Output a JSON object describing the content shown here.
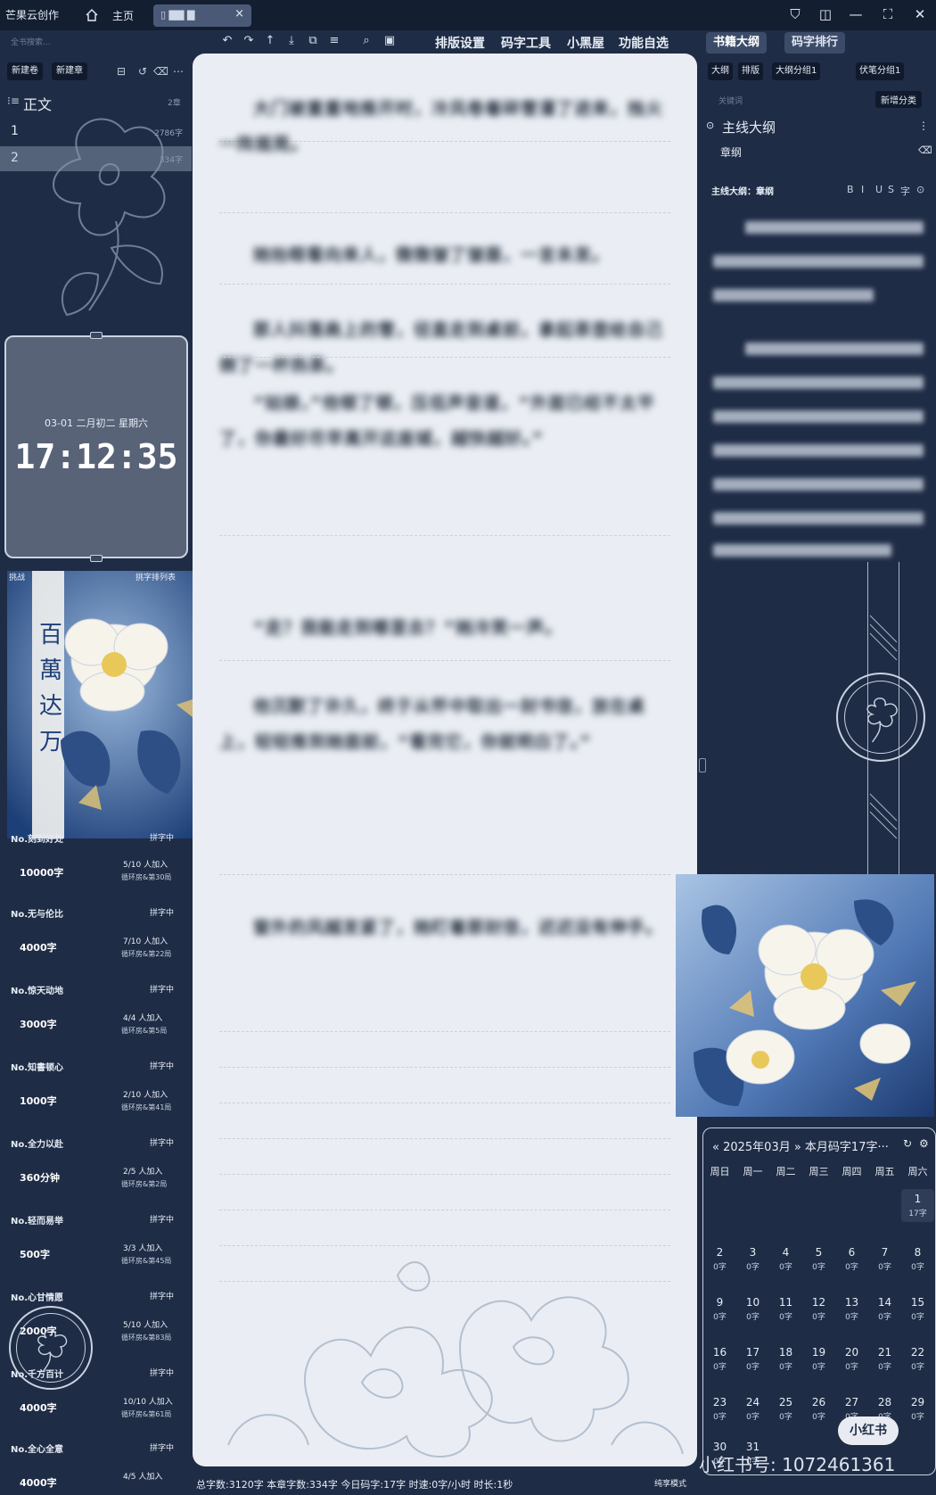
{
  "titlebar": {
    "app_name": "芒果云创作",
    "home_tab": "主页",
    "doc_tab_close": "×"
  },
  "left": {
    "search_placeholder": "全书搜索...",
    "new_volume": "新建卷",
    "new_chapter": "新建章",
    "section_label": "正文",
    "section_count": "2章",
    "chapters": [
      {
        "num": "1",
        "words": "2786字"
      },
      {
        "num": "2",
        "words": "334字"
      }
    ],
    "clock": {
      "date": "03-01  二月初二  星期六",
      "time": "17:12:35"
    },
    "challenge_header_left": "挑战",
    "challenge_header_right": "挑字排列表",
    "challenges": [
      {
        "title": "No.无与伦比",
        "status": "拼字中",
        "target": "4000字",
        "progress": "7/10 人加入",
        "rank": "循环房&第22局"
      },
      {
        "title": "No.惊天动地",
        "status": "拼字中",
        "target": "3000字",
        "progress": "4/4 人加入",
        "rank": "循环房&第5局"
      },
      {
        "title": "No.知書顿心",
        "status": "拼字中",
        "target": "1000字",
        "progress": "2/10 人加入",
        "rank": "循环房&第41局"
      },
      {
        "title": "No.全力以赴",
        "status": "拼字中",
        "target": "360分钟",
        "progress": "2/5 人加入",
        "rank": "循环房&第2局"
      },
      {
        "title": "No.轻而易举",
        "status": "拼字中",
        "target": "500字",
        "progress": "3/3 人加入",
        "rank": "循环房&第45局"
      },
      {
        "title": "No.心甘情愿",
        "status": "拼字中",
        "target": "2000字",
        "progress": "5/10 人加入",
        "rank": "循环房&第83局"
      },
      {
        "title": "No.千方百计",
        "status": "拼字中",
        "target": "4000字",
        "progress": "10/10 人加入",
        "rank": "循环房&第61局"
      },
      {
        "title": "No.全心全意",
        "status": "拼字中",
        "target": "4000字",
        "progress": "4/5 人加入",
        "rank": ""
      }
    ],
    "pre_items": [
      {
        "title": "No.刻到好处",
        "status": "拼字中",
        "target": "10000字",
        "progress": "5/10 人加入",
        "rank": "循环房&第30局"
      },
      {
        "title": "",
        "status": "",
        "target": "500字",
        "progress": "10/10 人加入",
        "rank": ""
      }
    ]
  },
  "toolbar": {
    "menu": [
      "排版设置",
      "码字工具",
      "小黑屋",
      "功能自选"
    ],
    "icons": [
      "undo-icon",
      "redo-icon",
      "arrow-up-icon",
      "arrow-down-icon",
      "copy-icon",
      "format-icon",
      "search-icon",
      "save-icon"
    ]
  },
  "editor": {
    "paragraphs": [
      "大门被重重地推开时，冷风卷着碎雪灌了进来，烛火一阵摇晃。",
      "她抬眼看向来人，微微皱了皱眉，一言未发。",
      "那人抖落肩上的雪，径直走到桌前，拿起茶壶给自己倒了一杯热茶。",
      "“姑娘，”他顿了顿，压低声音道，“外面已经不太平了，你最好尽早离开这座城，越快越好。”",
      "“走？我能走到哪里去？”她冷笑一声。",
      "他沉默了许久，终于从怀中取出一封书信，放在桌上，轻轻推到她面前，“看完它，你就明白了。”",
      "窗外的风越发紧了，她盯着那封信，迟迟没有伸手。"
    ]
  },
  "status_bar": {
    "text": "总字数:3120字  本章字数:334字  今日码字:17字  时速:0字/小时  时长:1秒",
    "mode": "纯享模式"
  },
  "right": {
    "tab_outline": "书籍大纲",
    "tab_rank": "码字排行",
    "subtabs": [
      "大纲",
      "排版",
      "大纲分组1",
      "伏笔分组1"
    ],
    "keyword_placeholder": "关键词",
    "new_category": "新增分类",
    "main_outline": "主线大纲",
    "chapter_outline": "章纲",
    "breadcrumb": "主线大纲：章纲",
    "format_buttons": [
      "B",
      "I",
      "U",
      "S",
      "字",
      "⊙"
    ],
    "outline_lines": 10
  },
  "calendar": {
    "month_label": "« 2025年03月 » 本月码字17字···",
    "weekdays": [
      "周日",
      "周一",
      "周二",
      "周三",
      "周四",
      "周五",
      "周六"
    ],
    "days": [
      {
        "d": "1",
        "w": "17字"
      },
      {
        "d": "2",
        "w": "0字"
      },
      {
        "d": "3",
        "w": "0字"
      },
      {
        "d": "4",
        "w": "0字"
      },
      {
        "d": "5",
        "w": "0字"
      },
      {
        "d": "6",
        "w": "0字"
      },
      {
        "d": "7",
        "w": "0字"
      },
      {
        "d": "8",
        "w": "0字"
      },
      {
        "d": "9",
        "w": "0字"
      },
      {
        "d": "10",
        "w": "0字"
      },
      {
        "d": "11",
        "w": "0字"
      },
      {
        "d": "12",
        "w": "0字"
      },
      {
        "d": "13",
        "w": "0字"
      },
      {
        "d": "14",
        "w": "0字"
      },
      {
        "d": "15",
        "w": "0字"
      },
      {
        "d": "16",
        "w": "0字"
      },
      {
        "d": "17",
        "w": "0字"
      },
      {
        "d": "18",
        "w": "0字"
      },
      {
        "d": "19",
        "w": "0字"
      },
      {
        "d": "20",
        "w": "0字"
      },
      {
        "d": "21",
        "w": "0字"
      },
      {
        "d": "22",
        "w": "0字"
      },
      {
        "d": "23",
        "w": "0字"
      },
      {
        "d": "24",
        "w": "0字"
      },
      {
        "d": "25",
        "w": "0字"
      },
      {
        "d": "26",
        "w": "0字"
      },
      {
        "d": "27",
        "w": "0字"
      },
      {
        "d": "28",
        "w": "0字"
      },
      {
        "d": "29",
        "w": "0字"
      },
      {
        "d": "30",
        "w": "0字"
      },
      {
        "d": "31",
        "w": "0字"
      }
    ]
  },
  "watermark": {
    "id": "小红书号: 1072461361",
    "logo": "小红书"
  }
}
